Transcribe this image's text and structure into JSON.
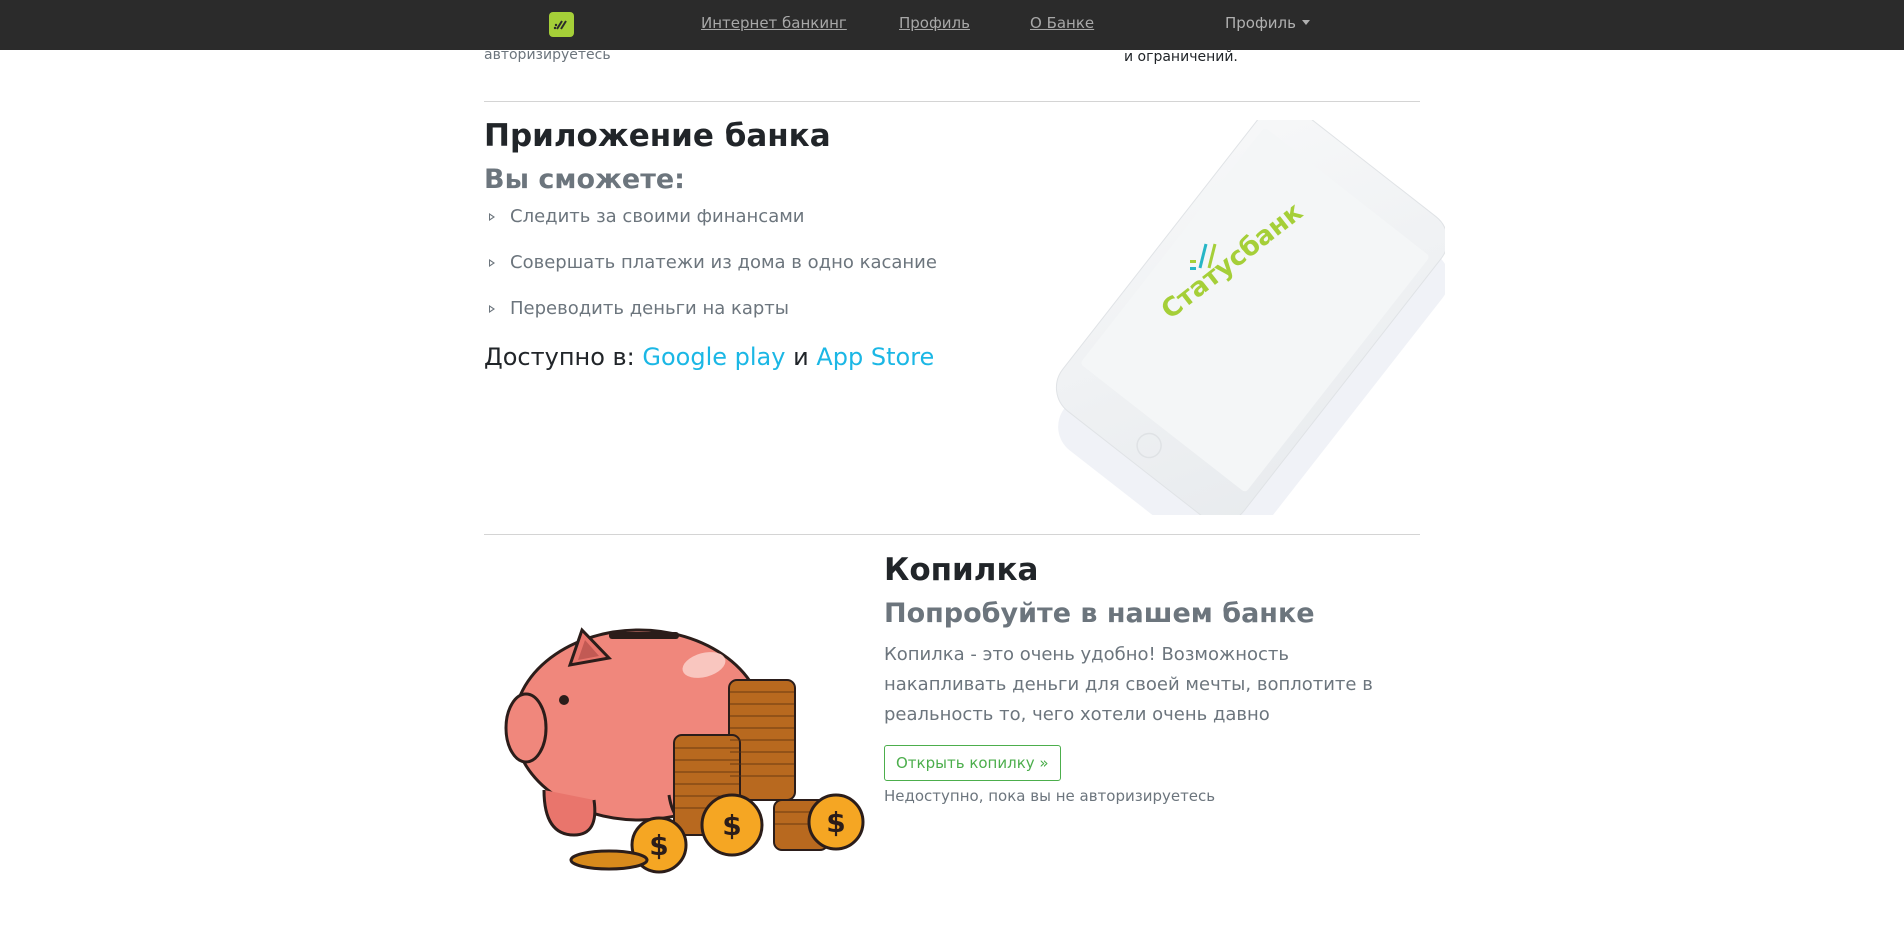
{
  "nav": {
    "links": [
      "Интернет банкинг",
      "Профиль",
      "О Банке"
    ],
    "profile_dropdown": "Профиль"
  },
  "top_fragment": {
    "left_note": "авторизируетесь",
    "right_note": "и ограничений."
  },
  "app_section": {
    "title": "Приложение банка",
    "subtitle": "Вы сможете:",
    "features": [
      "Следить за своими финансами",
      "Совершать платежи из дома в одно касание",
      "Переводить деньги на карты"
    ],
    "available_prefix": "Доступно в:",
    "store_google": "Google play",
    "conjunction": "и",
    "store_apple": "App Store",
    "phone_brand_text": "Статусбанк"
  },
  "piggy_section": {
    "title": "Копилка",
    "subtitle": "Попробуйте в нашем банке",
    "description": "Копилка - это очень удобно! Возможность накапливать деньги для своей мечты, воплотите в реальность то, чего хотели очень давно",
    "button_label": "Открыть копилку »",
    "note": "Недоступно, пока вы не авторизируетесь"
  },
  "colors": {
    "navbar_bg": "#2b2b2b",
    "brand_green": "#a5cf38",
    "link_blue": "#1bb7e5",
    "button_green": "#4cae4c"
  },
  "icons": [
    "bank-logo-icon",
    "caret-down-icon",
    "triangle-bullet-icon"
  ]
}
